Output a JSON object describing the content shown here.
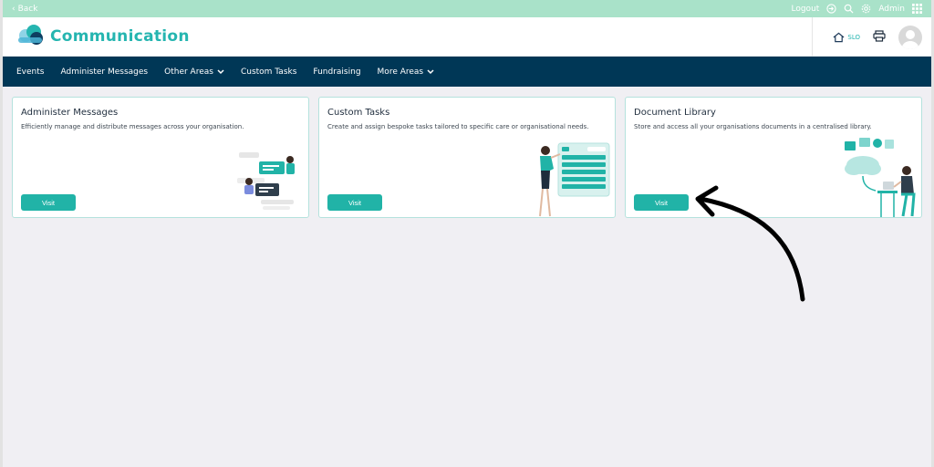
{
  "topbar": {
    "back_label": "Back",
    "logout_label": "Logout",
    "user_label": "Admin"
  },
  "header": {
    "title": "Communication",
    "home_label": "SLO"
  },
  "nav": {
    "items": [
      {
        "label": "Events"
      },
      {
        "label": "Administer Messages"
      },
      {
        "label": "Other Areas",
        "dropdown": true
      },
      {
        "label": "Custom Tasks"
      },
      {
        "label": "Fundraising"
      },
      {
        "label": "More Areas",
        "dropdown": true
      }
    ]
  },
  "cards": [
    {
      "title": "Administer Messages",
      "description": "Efficiently manage and distribute messages across your organisation.",
      "button": "Visit"
    },
    {
      "title": "Custom Tasks",
      "description": "Create and assign bespoke tasks tailored to specific care or organisational needs.",
      "button": "Visit"
    },
    {
      "title": "Document Library",
      "description": "Store and access all your organisations documents in a centralised library.",
      "button": "Visit"
    }
  ],
  "colors": {
    "accent": "#21b3a7",
    "nav_bg": "#003756",
    "topbar_bg": "#a9e2c9",
    "brand": "#25b5b0"
  },
  "icons": {
    "back": "chevron-left-icon",
    "logout": "logout-icon",
    "search": "search-icon",
    "settings": "gear-icon",
    "apps": "grid-icon",
    "home": "home-icon",
    "print": "printer-icon"
  }
}
